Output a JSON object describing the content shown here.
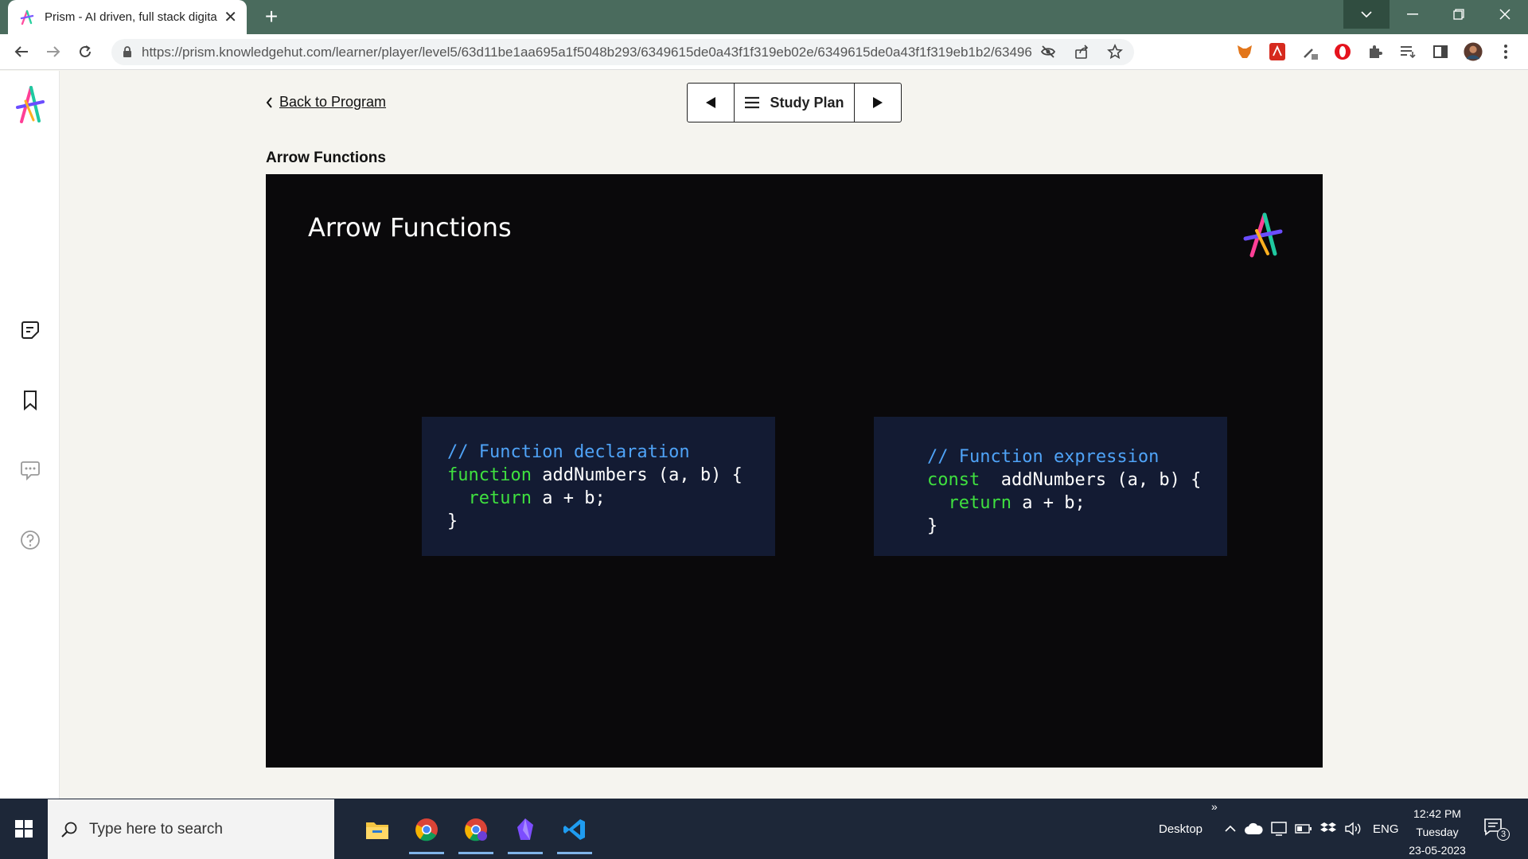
{
  "browser": {
    "tab_title": "Prism - AI driven, full stack digital",
    "url": "https://prism.knowledgehut.com/learner/player/level5/63d11be1aa695a1f5048b293/6349615de0a43f1f319eb02e/6349615de0a43f1f319eb1b2/6349615de0a4..."
  },
  "nav": {
    "back_label": "Back to Program",
    "study_plan_label": "Study Plan"
  },
  "lesson": {
    "title": "Arrow Functions"
  },
  "slide": {
    "title": "Arrow Functions",
    "left_code": {
      "comment": "// Function declaration",
      "keyword": "function",
      "signature": " addNumbers (a, b) {",
      "return_kw": "return",
      "return_expr": " a + b;",
      "close": "}"
    },
    "right_code": {
      "comment": "// Function expression",
      "keyword": "const",
      "signature": "  addNumbers (a, b) {",
      "return_kw": "return",
      "return_expr": " a + b;",
      "close": "}"
    }
  },
  "taskbar": {
    "search_placeholder": "Type here to search",
    "desktop_label": "Desktop",
    "lang": "ENG",
    "time": "12:42 PM",
    "day": "Tuesday",
    "date": "23-05-2023",
    "notification_count": "3"
  },
  "colors": {
    "tabstrip": "#4a6b5d",
    "slide_bg": "#0a090b",
    "code_bg": "#131b33",
    "code_comment": "#4fa3f7",
    "code_keyword": "#3fe03f"
  }
}
